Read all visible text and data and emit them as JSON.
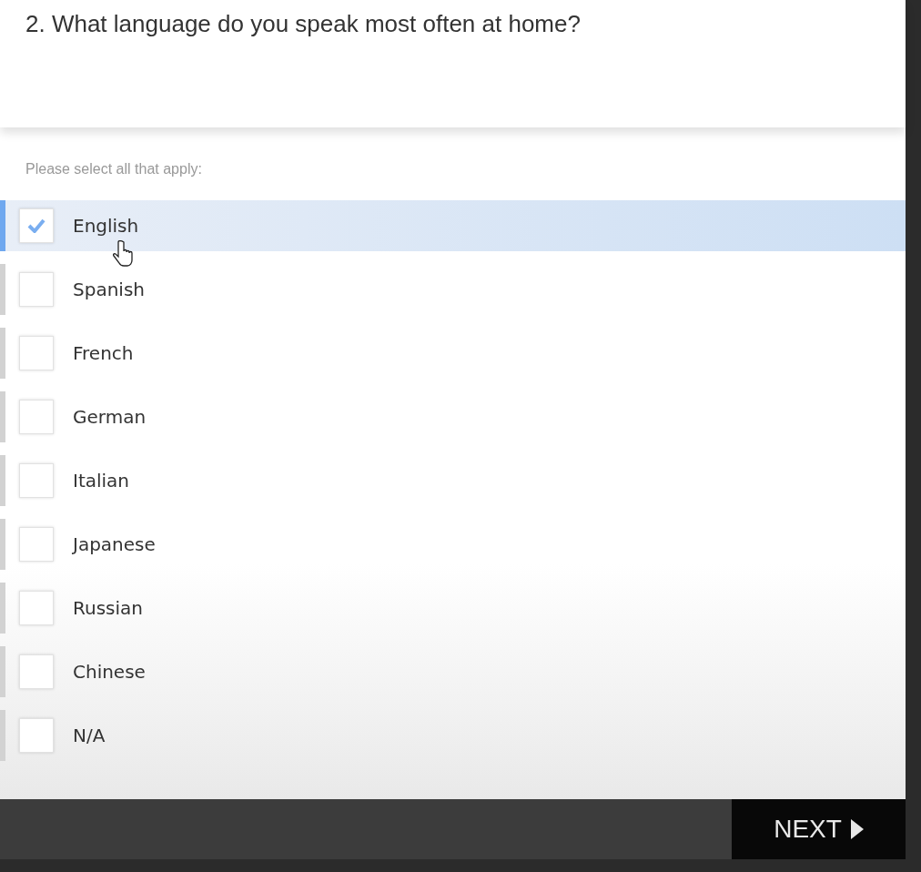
{
  "question": {
    "title": "2. What language do you speak most often at home?"
  },
  "instruction": "Please select all that apply:",
  "options": [
    {
      "label": "English",
      "checked": true,
      "selected": true
    },
    {
      "label": "Spanish",
      "checked": false,
      "selected": false
    },
    {
      "label": "French",
      "checked": false,
      "selected": false
    },
    {
      "label": "German",
      "checked": false,
      "selected": false
    },
    {
      "label": "Italian",
      "checked": false,
      "selected": false
    },
    {
      "label": "Japanese",
      "checked": false,
      "selected": false
    },
    {
      "label": "Russian",
      "checked": false,
      "selected": false
    },
    {
      "label": "Chinese",
      "checked": false,
      "selected": false
    },
    {
      "label": "N/A",
      "checked": false,
      "selected": false
    }
  ],
  "footer": {
    "next_button": "NEXT"
  }
}
